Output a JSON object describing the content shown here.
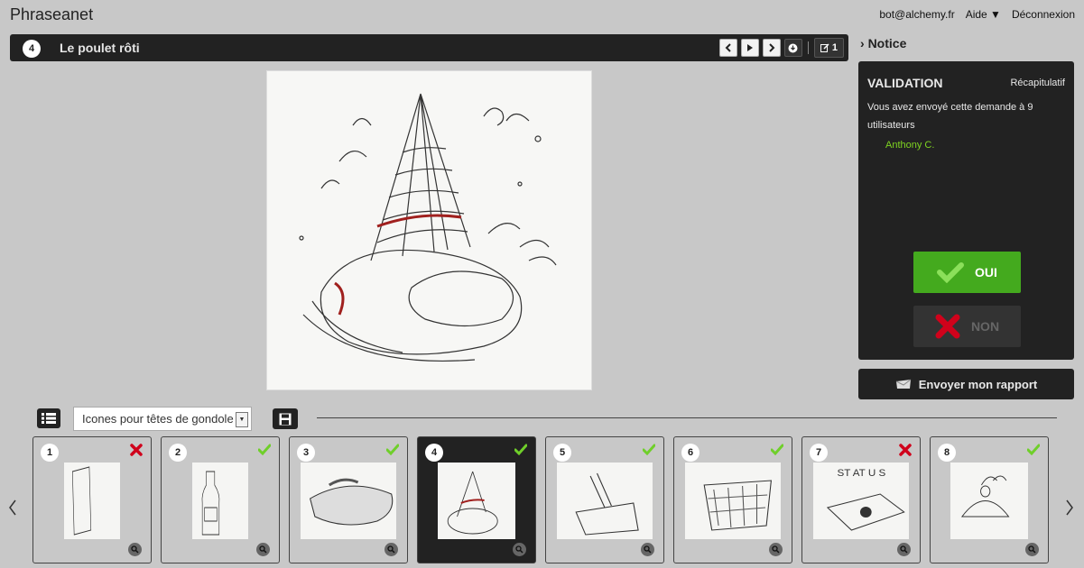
{
  "app": {
    "title": "Phraseanet"
  },
  "topnav": {
    "user": "bot@alchemy.fr",
    "help": "Aide ▼",
    "logout": "Déconnexion"
  },
  "record": {
    "number": "4",
    "title": "Le poulet rôti",
    "edit_count": "1"
  },
  "notice": {
    "label": "Notice"
  },
  "validation": {
    "title": "VALIDATION",
    "recap": "Récapitulatif",
    "message": "Vous avez envoyé cette demande à 9 utilisateurs",
    "user": "Anthony C.",
    "oui": "OUI",
    "non": "NON",
    "send_report": "Envoyer mon rapport",
    "colors": {
      "approve": "#44aa1e",
      "user": "#7ed321",
      "reject": "#d0021b"
    }
  },
  "basket": {
    "selected": "Icones pour têtes de gondoles"
  },
  "thumbnails": [
    {
      "number": "1",
      "status": "rejected",
      "image": "tall box sketch"
    },
    {
      "number": "2",
      "status": "approved",
      "image": "bottle sketch"
    },
    {
      "number": "3",
      "status": "approved",
      "image": "roast sketch"
    },
    {
      "number": "4",
      "status": "approved",
      "image": "party hat chicken sketch"
    },
    {
      "number": "5",
      "status": "approved",
      "image": "pen and paper sketch"
    },
    {
      "number": "6",
      "status": "approved",
      "image": "basket sketch"
    },
    {
      "number": "7",
      "status": "rejected",
      "image": "status book sketch"
    },
    {
      "number": "8",
      "status": "approved",
      "image": "cloche sketch"
    }
  ]
}
